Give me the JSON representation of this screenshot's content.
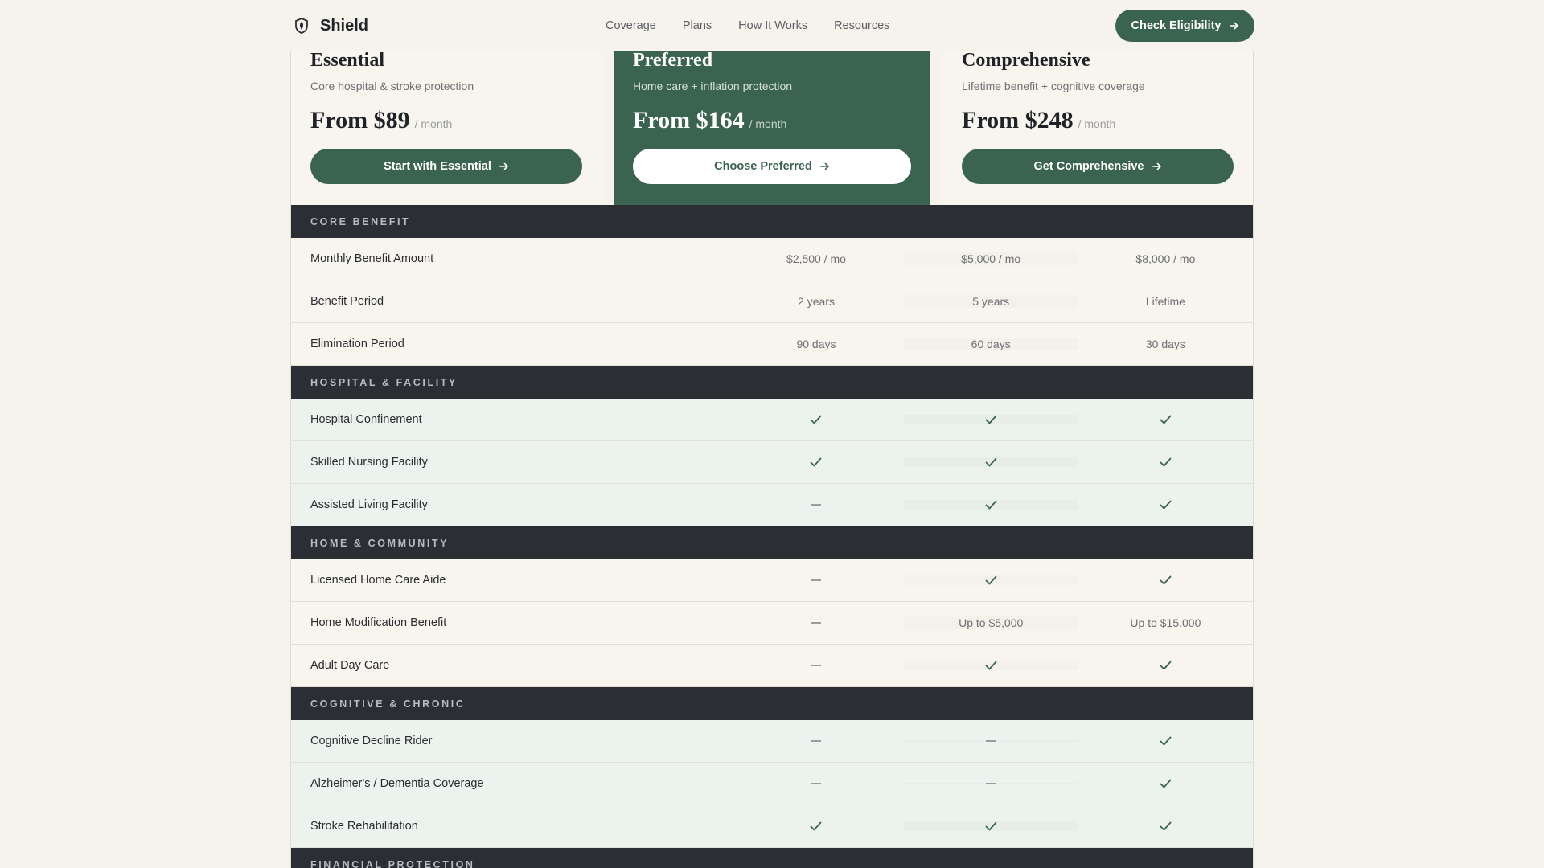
{
  "nav": {
    "brand": "Shield",
    "items": [
      "Coverage",
      "Plans",
      "How It Works",
      "Resources"
    ],
    "cta_label": "Check Eligibility",
    "logo_icon": "shield-icon"
  },
  "plans": [
    {
      "name": "Essential",
      "subtitle": "Core hospital & stroke protection",
      "price": "From $89",
      "per": "/ month",
      "button": "Start with Essential"
    },
    {
      "name": "Preferred",
      "subtitle": "Home care + inflation protection",
      "price": "From $164",
      "per": "/ month",
      "button": "Choose Preferred"
    },
    {
      "name": "Comprehensive",
      "subtitle": "Lifetime benefit + cognitive coverage",
      "price": "From $248",
      "per": "/ month",
      "button": "Get Comprehensive"
    }
  ],
  "sections": [
    {
      "title": "CORE BENEFIT",
      "tint": "plain",
      "rows": [
        {
          "label": "Monthly Benefit Amount",
          "values": [
            "$2,500 / mo",
            "$5,000 / mo",
            "$8,000 / mo"
          ]
        },
        {
          "label": "Benefit Period",
          "values": [
            "2 years",
            "5 years",
            "Lifetime"
          ]
        },
        {
          "label": "Elimination Period",
          "values": [
            "90 days",
            "60 days",
            "30 days"
          ]
        }
      ]
    },
    {
      "title": "HOSPITAL & FACILITY",
      "tint": "mint",
      "rows": [
        {
          "label": "Hospital Confinement",
          "values": [
            "check",
            "check",
            "check"
          ]
        },
        {
          "label": "Skilled Nursing Facility",
          "values": [
            "check",
            "check",
            "check"
          ]
        },
        {
          "label": "Assisted Living Facility",
          "values": [
            "dash",
            "check",
            "check"
          ]
        }
      ]
    },
    {
      "title": "HOME & COMMUNITY",
      "tint": "plain",
      "rows": [
        {
          "label": "Licensed Home Care Aide",
          "values": [
            "dash",
            "check",
            "check"
          ]
        },
        {
          "label": "Home Modification Benefit",
          "values": [
            "dash",
            "Up to $5,000",
            "Up to $15,000"
          ]
        },
        {
          "label": "Adult Day Care",
          "values": [
            "dash",
            "check",
            "check"
          ]
        }
      ]
    },
    {
      "title": "COGNITIVE & CHRONIC",
      "tint": "mint",
      "rows": [
        {
          "label": "Cognitive Decline Rider",
          "values": [
            "dash",
            "dash",
            "check"
          ]
        },
        {
          "label": "Alzheimer's / Dementia Coverage",
          "values": [
            "dash",
            "dash",
            "check"
          ]
        },
        {
          "label": "Stroke Rehabilitation",
          "values": [
            "check",
            "check",
            "check"
          ]
        }
      ]
    },
    {
      "title": "FINANCIAL PROTECTION",
      "tint": "plain",
      "rows": []
    }
  ],
  "colors": {
    "brand_green": "#3b6450",
    "section_bar": "#2b2e33",
    "background": "#f6f3ec",
    "mint_row": "#ecf2ee"
  }
}
